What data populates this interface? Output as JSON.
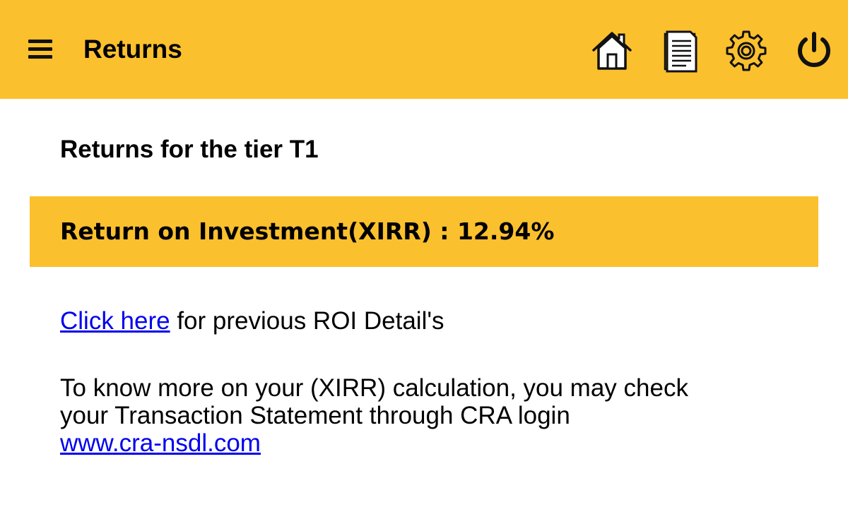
{
  "appbar": {
    "title": "Returns",
    "background_color": "#fbc02d",
    "icons": [
      "menu-icon",
      "home-icon",
      "document-icon",
      "gear-icon",
      "power-icon"
    ]
  },
  "content": {
    "section_title": "Returns for the tier T1",
    "roi_text": "Return on Investment(XIRR) : 12.94%",
    "prev_link_label": "Click here",
    "prev_suffix": " for previous ROI Detail's",
    "info_line1": "To know more on your (XIRR) calculation, you may check",
    "info_line2": "your Transaction Statement through CRA login",
    "cra_link": "www.cra-nsdl.com",
    "link_color": "#0000ee"
  }
}
